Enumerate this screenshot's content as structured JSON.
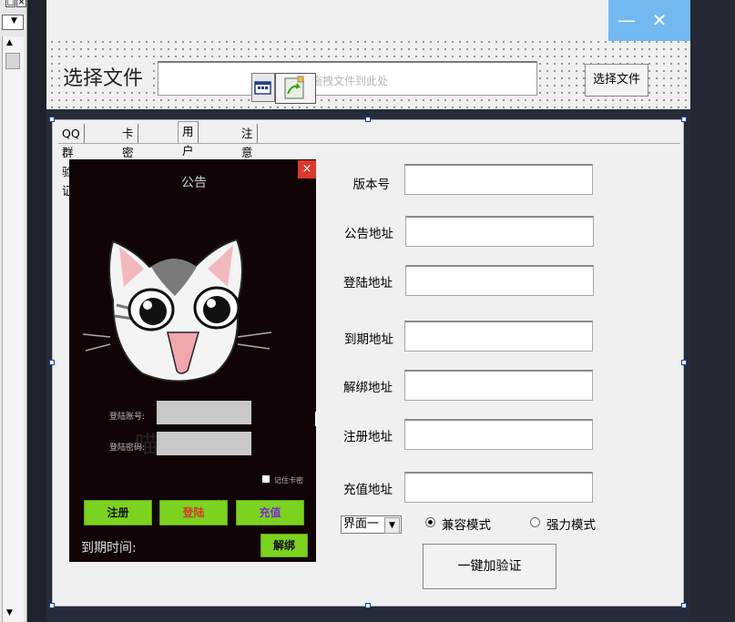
{
  "toolbar": {
    "select_file_label": "选择文件",
    "drop_hint": "拖拽文件到此处",
    "choose_file_button": "选择文件",
    "minimize_glyph": "—",
    "close_glyph": "✕"
  },
  "tabs": [
    {
      "label": "QQ群验证"
    },
    {
      "label": "卡密验证"
    },
    {
      "label": "用户验证"
    },
    {
      "label": "注意事项"
    }
  ],
  "preview": {
    "title": "公告",
    "close_glyph": "×",
    "account_label": "登陆账号:",
    "password_label": "登陆密码:",
    "remember_label": "记住卡密",
    "register_button": "注册",
    "login_button": "登陆",
    "recharge_button": "充值",
    "expiry_label": "到期时间:",
    "unbind_button": "解绑"
  },
  "form": {
    "fields": [
      {
        "label": "版本号",
        "value": ""
      },
      {
        "label": "公告地址",
        "value": ""
      },
      {
        "label": "登陆地址",
        "value": ""
      },
      {
        "label": "到期地址",
        "value": ""
      },
      {
        "label": "解绑地址",
        "value": ""
      },
      {
        "label": "注册地址",
        "value": ""
      },
      {
        "label": "充值地址",
        "value": ""
      }
    ],
    "interface_select": "界面一",
    "mode_compat": "兼容模式",
    "mode_strong": "强力模式",
    "mode_selected": "兼容模式",
    "verify_button": "一键加验证"
  },
  "colors": {
    "titlebar_accent": "#72b9f2",
    "preview_bg": "#100404",
    "green_button": "#7bd21f",
    "red_close": "#d93a2b"
  }
}
